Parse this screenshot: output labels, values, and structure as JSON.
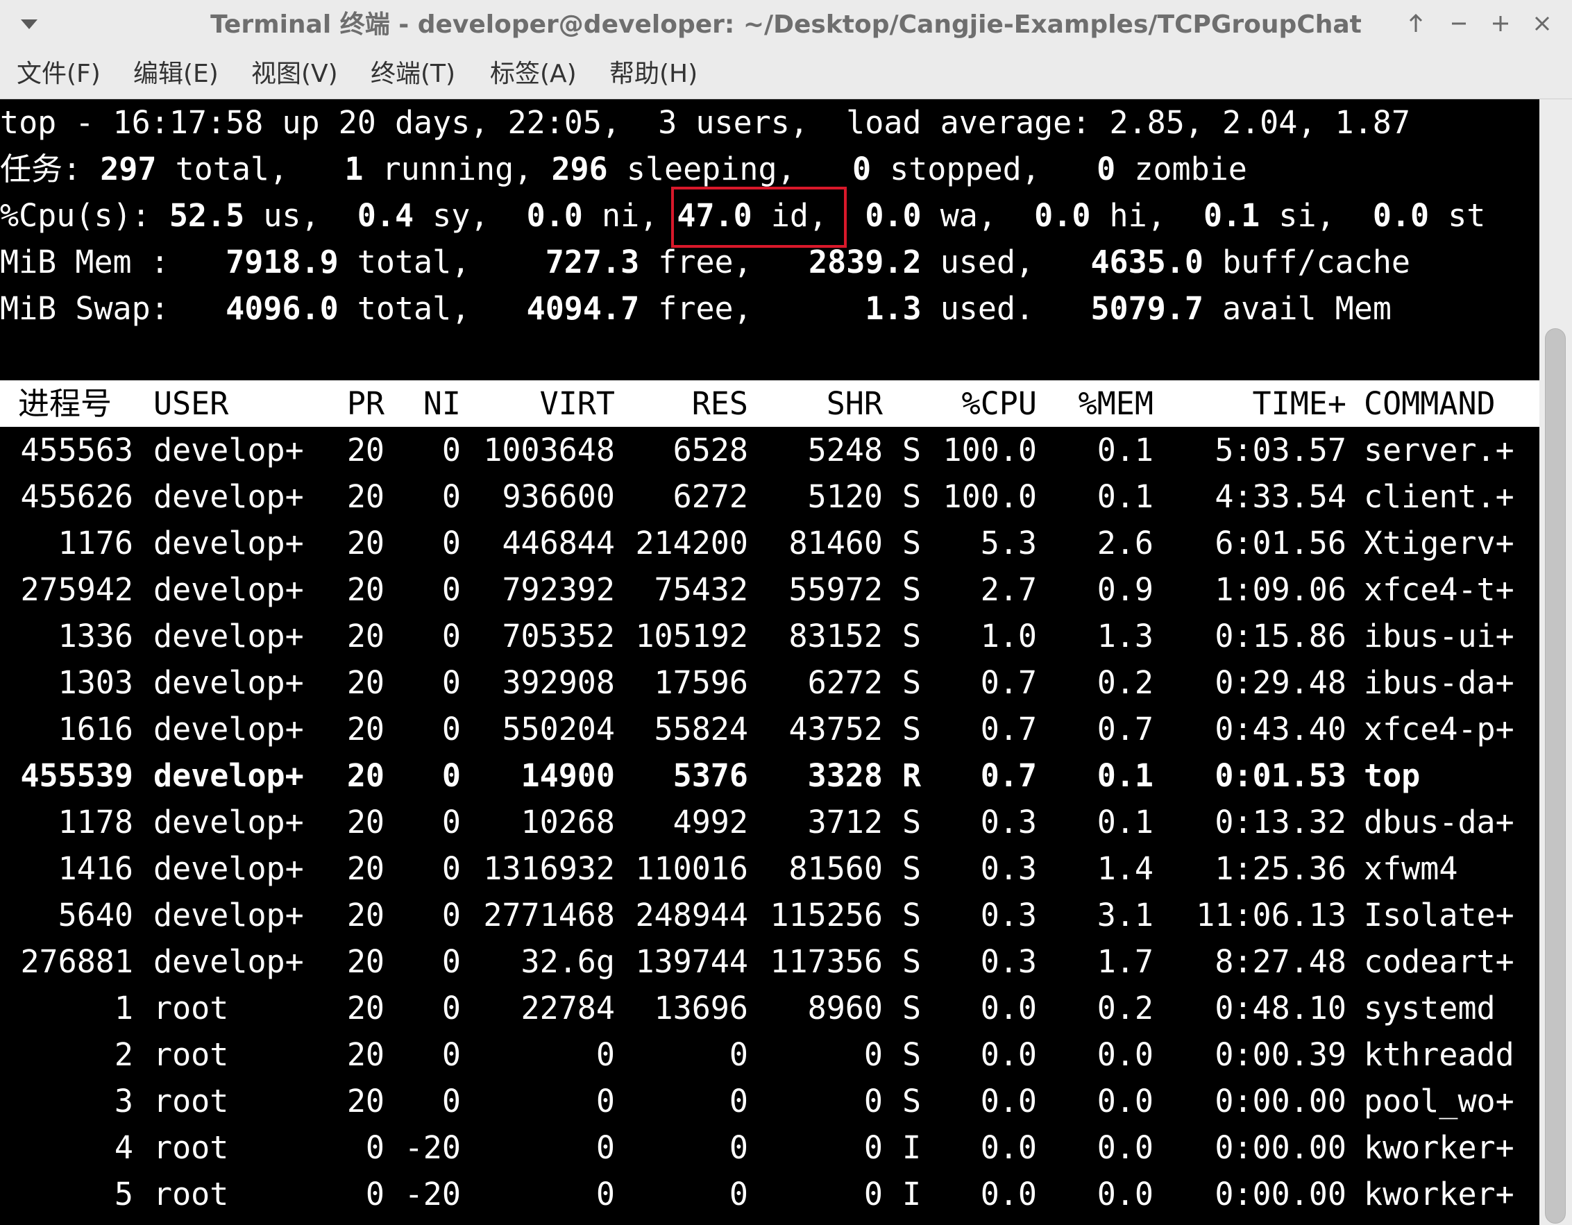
{
  "window": {
    "title": "Terminal 终端 - developer@developer: ~/Desktop/Cangjie-Examples/TCPGroupChat",
    "icons": [
      "wm-menu-icon",
      "arrow-up-icon",
      "minimize-icon",
      "maximize-icon",
      "close-icon"
    ]
  },
  "menu": {
    "file": "文件(F)",
    "edit": "编辑(E)",
    "view": "视图(V)",
    "terminal": "终端(T)",
    "tabs": "标签(A)",
    "help": "帮助(H)"
  },
  "summary": {
    "line1": "top - 16:17:58 up 20 days, 22:05,  3 users,  load average: 2.85, 2.04, 1.87",
    "tasks": {
      "label": "任务:",
      "total": "297",
      "total_label": "total,",
      "running": "1",
      "running_label": "running,",
      "sleeping": "296",
      "sleeping_label": "sleeping,",
      "stopped": "0",
      "stopped_label": "stopped,",
      "zombie": "0",
      "zombie_label": "zombie"
    },
    "cpu": {
      "label": "%Cpu(s):",
      "us": "52.5",
      "us_label": "us,",
      "sy": "0.4",
      "sy_label": "sy,",
      "ni": "0.0",
      "ni_label": "ni,",
      "id": "47.0",
      "id_label": "id,",
      "wa": "0.0",
      "wa_label": "wa,",
      "hi": "0.0",
      "hi_label": "hi,",
      "si": "0.1",
      "si_label": "si,",
      "st": "0.0",
      "st_label": "st"
    },
    "mem": {
      "label": "MiB Mem :",
      "total": "7918.9",
      "total_label": "total,",
      "free": "727.3",
      "free_label": "free,",
      "used": "2839.2",
      "used_label": "used,",
      "buff": "4635.0",
      "buff_label": "buff/cache"
    },
    "swap": {
      "label": "MiB Swap:",
      "total": "4096.0",
      "total_label": "total,",
      "free": "4094.7",
      "free_label": "free,",
      "used": "1.3",
      "used_label": "used.",
      "avail": "5079.7",
      "avail_label": "avail Mem"
    },
    "highlight_color": "#d8182a"
  },
  "columns": [
    "进程号",
    "USER",
    "PR",
    "NI",
    "VIRT",
    "RES",
    "SHR",
    "",
    "%CPU",
    "%MEM",
    "TIME+",
    "COMMAND"
  ],
  "processes": [
    {
      "pid": "455563",
      "user": "develop+",
      "pr": "20",
      "ni": "0",
      "virt": "1003648",
      "res": "6528",
      "shr": "5248",
      "s": "S",
      "cpu": "100.0",
      "mem": "0.1",
      "time": "5:03.57",
      "cmd": "server.+"
    },
    {
      "pid": "455626",
      "user": "develop+",
      "pr": "20",
      "ni": "0",
      "virt": "936600",
      "res": "6272",
      "shr": "5120",
      "s": "S",
      "cpu": "100.0",
      "mem": "0.1",
      "time": "4:33.54",
      "cmd": "client.+"
    },
    {
      "pid": "1176",
      "user": "develop+",
      "pr": "20",
      "ni": "0",
      "virt": "446844",
      "res": "214200",
      "shr": "81460",
      "s": "S",
      "cpu": "5.3",
      "mem": "2.6",
      "time": "6:01.56",
      "cmd": "Xtigerv+"
    },
    {
      "pid": "275942",
      "user": "develop+",
      "pr": "20",
      "ni": "0",
      "virt": "792392",
      "res": "75432",
      "shr": "55972",
      "s": "S",
      "cpu": "2.7",
      "mem": "0.9",
      "time": "1:09.06",
      "cmd": "xfce4-t+"
    },
    {
      "pid": "1336",
      "user": "develop+",
      "pr": "20",
      "ni": "0",
      "virt": "705352",
      "res": "105192",
      "shr": "83152",
      "s": "S",
      "cpu": "1.0",
      "mem": "1.3",
      "time": "0:15.86",
      "cmd": "ibus-ui+"
    },
    {
      "pid": "1303",
      "user": "develop+",
      "pr": "20",
      "ni": "0",
      "virt": "392908",
      "res": "17596",
      "shr": "6272",
      "s": "S",
      "cpu": "0.7",
      "mem": "0.2",
      "time": "0:29.48",
      "cmd": "ibus-da+"
    },
    {
      "pid": "1616",
      "user": "develop+",
      "pr": "20",
      "ni": "0",
      "virt": "550204",
      "res": "55824",
      "shr": "43752",
      "s": "S",
      "cpu": "0.7",
      "mem": "0.7",
      "time": "0:43.40",
      "cmd": "xfce4-p+"
    },
    {
      "pid": "455539",
      "user": "develop+",
      "pr": "20",
      "ni": "0",
      "virt": "14900",
      "res": "5376",
      "shr": "3328",
      "s": "R",
      "cpu": "0.7",
      "mem": "0.1",
      "time": "0:01.53",
      "cmd": "top",
      "bold": true
    },
    {
      "pid": "1178",
      "user": "develop+",
      "pr": "20",
      "ni": "0",
      "virt": "10268",
      "res": "4992",
      "shr": "3712",
      "s": "S",
      "cpu": "0.3",
      "mem": "0.1",
      "time": "0:13.32",
      "cmd": "dbus-da+"
    },
    {
      "pid": "1416",
      "user": "develop+",
      "pr": "20",
      "ni": "0",
      "virt": "1316932",
      "res": "110016",
      "shr": "81560",
      "s": "S",
      "cpu": "0.3",
      "mem": "1.4",
      "time": "1:25.36",
      "cmd": "xfwm4"
    },
    {
      "pid": "5640",
      "user": "develop+",
      "pr": "20",
      "ni": "0",
      "virt": "2771468",
      "res": "248944",
      "shr": "115256",
      "s": "S",
      "cpu": "0.3",
      "mem": "3.1",
      "time": "11:06.13",
      "cmd": "Isolate+"
    },
    {
      "pid": "276881",
      "user": "develop+",
      "pr": "20",
      "ni": "0",
      "virt": "32.6g",
      "res": "139744",
      "shr": "117356",
      "s": "S",
      "cpu": "0.3",
      "mem": "1.7",
      "time": "8:27.48",
      "cmd": "codeart+"
    },
    {
      "pid": "1",
      "user": "root",
      "pr": "20",
      "ni": "0",
      "virt": "22784",
      "res": "13696",
      "shr": "8960",
      "s": "S",
      "cpu": "0.0",
      "mem": "0.2",
      "time": "0:48.10",
      "cmd": "systemd"
    },
    {
      "pid": "2",
      "user": "root",
      "pr": "20",
      "ni": "0",
      "virt": "0",
      "res": "0",
      "shr": "0",
      "s": "S",
      "cpu": "0.0",
      "mem": "0.0",
      "time": "0:00.39",
      "cmd": "kthreadd"
    },
    {
      "pid": "3",
      "user": "root",
      "pr": "20",
      "ni": "0",
      "virt": "0",
      "res": "0",
      "shr": "0",
      "s": "S",
      "cpu": "0.0",
      "mem": "0.0",
      "time": "0:00.00",
      "cmd": "pool_wo+"
    },
    {
      "pid": "4",
      "user": "root",
      "pr": "0",
      "ni": "-20",
      "virt": "0",
      "res": "0",
      "shr": "0",
      "s": "I",
      "cpu": "0.0",
      "mem": "0.0",
      "time": "0:00.00",
      "cmd": "kworker+"
    },
    {
      "pid": "5",
      "user": "root",
      "pr": "0",
      "ni": "-20",
      "virt": "0",
      "res": "0",
      "shr": "0",
      "s": "I",
      "cpu": "0.0",
      "mem": "0.0",
      "time": "0:00.00",
      "cmd": "kworker+"
    }
  ]
}
